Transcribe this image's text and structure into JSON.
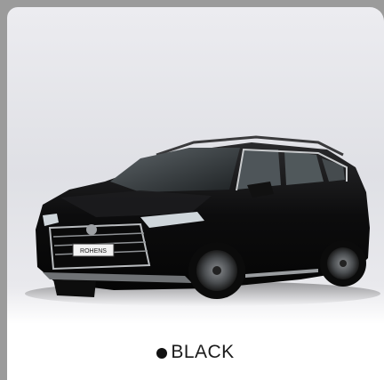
{
  "color_option": {
    "label": "BLACK",
    "swatch_color": "#111111",
    "icon": "color-dot-icon"
  },
  "product": {
    "image_icon": "car-icon",
    "plate_text": "ROHENS"
  }
}
